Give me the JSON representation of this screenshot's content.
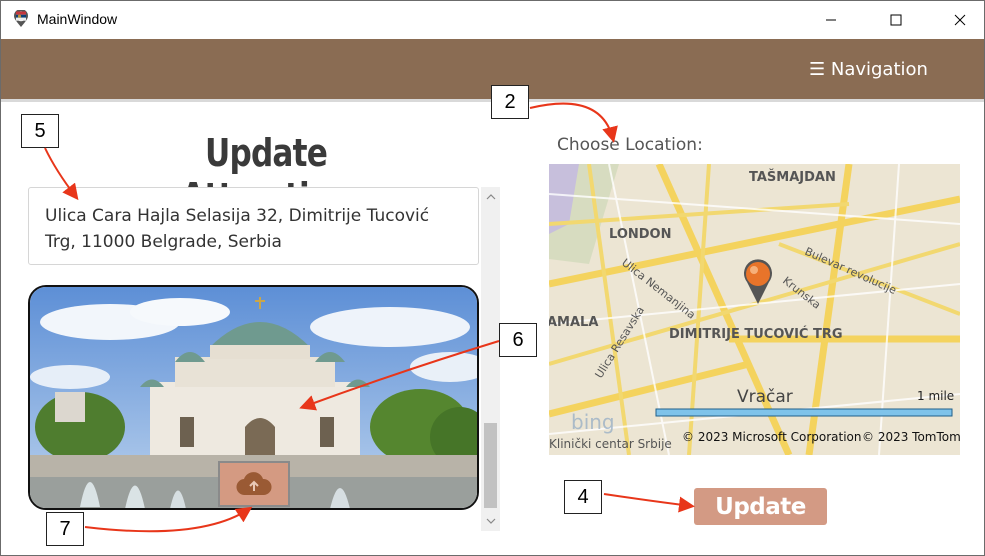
{
  "window": {
    "title": "MainWindow",
    "app_icon": "serbia-map-pin-icon",
    "controls": [
      "minimize-icon",
      "maximize-icon",
      "close-icon"
    ]
  },
  "header": {
    "nav_label": "☰ Navigation",
    "background_color": "#8a6c53"
  },
  "form": {
    "title": "Update Attraction",
    "address": "Ulica Cara Hajla Selasija 32, Dimitrije Tucović Trg, 11000 Belgrade, Serbia",
    "image_description": "photo of a domed cathedral with fountains",
    "upload_icon": "cloud-upload-icon",
    "update_label": "Update",
    "accent_color": "#d39a84"
  },
  "map": {
    "label": "Choose Location:",
    "places": [
      "TAŠMAJDAN",
      "LONDON",
      "AMALA",
      "DIMITRIJE TUCOVIĆ TRG",
      "Vračar"
    ],
    "streets": [
      "Bulevar revolucije",
      "Krunska",
      "Ulica Nemanjina",
      "Ulica Resavska"
    ],
    "poi": "Klinički centar Srbije",
    "scale_label": "1 mile",
    "logo": "bing",
    "copyright_ms": "© 2023 Microsoft Corporation",
    "copyright_tomtom": "© 2023 TomTom",
    "pin_icon": "map-pin-icon"
  },
  "annotations": {
    "c2": "2",
    "c4": "4",
    "c5": "5",
    "c6": "6",
    "c7": "7"
  }
}
